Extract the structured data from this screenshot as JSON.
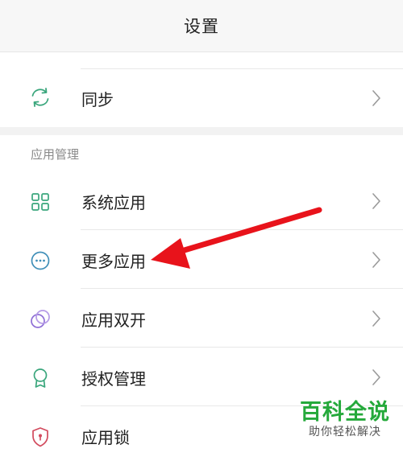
{
  "header": {
    "title": "设置"
  },
  "sync": {
    "label": "同步"
  },
  "section": {
    "label": "应用管理"
  },
  "items": [
    {
      "label": "系统应用",
      "icon": "grid-apps-icon"
    },
    {
      "label": "更多应用",
      "icon": "more-dots-icon"
    },
    {
      "label": "应用双开",
      "icon": "dual-circles-icon"
    },
    {
      "label": "授权管理",
      "icon": "badge-icon"
    },
    {
      "label": "应用锁",
      "icon": "shield-lock-icon"
    }
  ],
  "watermark": {
    "brand": "百科全说",
    "slogan": "助你轻松解决"
  },
  "colors": {
    "icon_green": "#3aa67c",
    "icon_purple": "#8f6fd6",
    "icon_red": "#d24a5d",
    "arrow_red": "#e8131b",
    "brand_green": "#25a93b"
  }
}
